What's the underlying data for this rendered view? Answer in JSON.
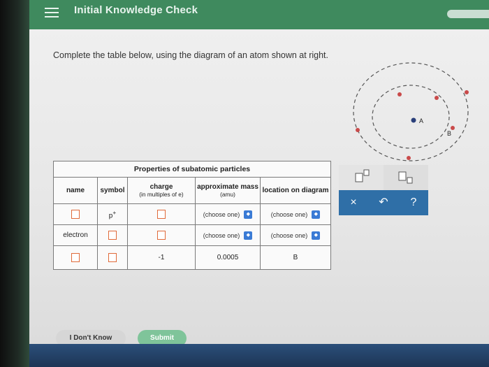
{
  "header": {
    "title": "Initial Knowledge Check"
  },
  "instructions": "Complete the table below, using the diagram of an atom shown at right.",
  "diagram": {
    "label_a": "A",
    "label_b": "B"
  },
  "table": {
    "caption": "Properties of subatomic particles",
    "headers": {
      "name": "name",
      "symbol": "symbol",
      "charge": "charge",
      "charge_sub": "(in multiples of e)",
      "mass": "approximate mass",
      "mass_sub": "(amu)",
      "location": "location on diagram"
    },
    "rows": [
      {
        "name": "",
        "symbol": "p",
        "symbol_sup": "+",
        "charge": "",
        "mass": "(choose one)",
        "location": "(choose one)"
      },
      {
        "name": "electron",
        "symbol": "",
        "charge": "",
        "mass": "(choose one)",
        "location": "(choose one)"
      },
      {
        "name": "",
        "symbol": "",
        "charge": "-1",
        "mass": "0.0005",
        "location": "B"
      }
    ]
  },
  "tools": {
    "clear": "×",
    "undo": "↶",
    "help": "?"
  },
  "buttons": {
    "dont_know": "I Don't Know",
    "submit": "Submit"
  },
  "colors": {
    "header": "#3f8a5e",
    "accent_blue": "#2f6fa7",
    "input_border": "#e06a3a",
    "submit": "#7fc49a"
  }
}
